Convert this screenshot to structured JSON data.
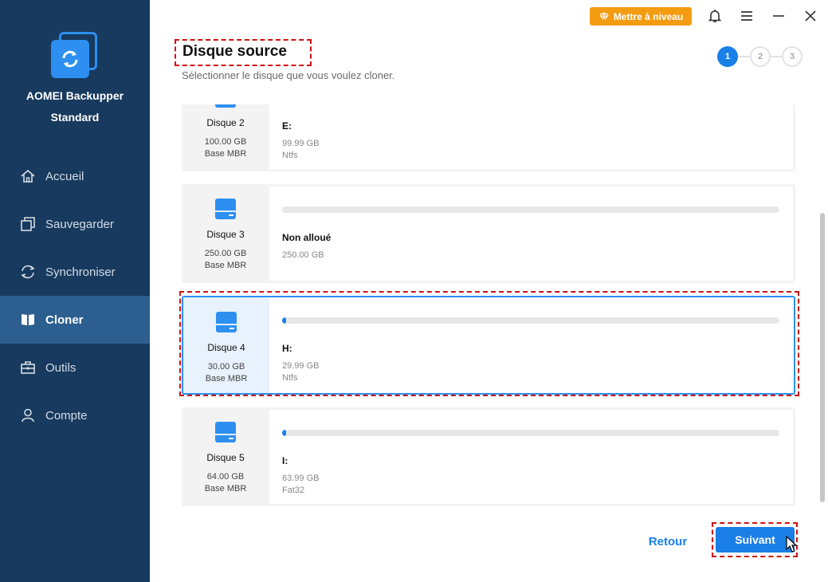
{
  "app": {
    "name": "AOMEI Backupper",
    "edition": "Standard"
  },
  "sidebar": {
    "items": [
      {
        "label": "Accueil",
        "icon": "home-icon",
        "active": false
      },
      {
        "label": "Sauvegarder",
        "icon": "copy-icon",
        "active": false
      },
      {
        "label": "Synchroniser",
        "icon": "sync-icon",
        "active": false
      },
      {
        "label": "Cloner",
        "icon": "clone-icon",
        "active": true
      },
      {
        "label": "Outils",
        "icon": "toolbox-icon",
        "active": false
      },
      {
        "label": "Compte",
        "icon": "user-icon",
        "active": false
      }
    ]
  },
  "topbar": {
    "upgrade_label": "Mettre à niveau"
  },
  "header": {
    "title": "Disque source",
    "subtitle": "Sélectionner le disque que vous voulez cloner."
  },
  "steps": [
    "1",
    "2",
    "3"
  ],
  "disks": [
    {
      "name": "Disque 2",
      "size": "100.00 GB",
      "type": "Base MBR",
      "partition": "E:",
      "part_size": "99.99 GB",
      "fs": "Ntfs",
      "usage": 0.0
    },
    {
      "name": "Disque 3",
      "size": "250.00 GB",
      "type": "Base MBR",
      "partition": "Non alloué",
      "part_size": "250.00 GB",
      "fs": "",
      "usage": 0.0
    },
    {
      "name": "Disque 4",
      "size": "30.00 GB",
      "type": "Base MBR",
      "partition": "H:",
      "part_size": "29.99 GB",
      "fs": "Ntfs",
      "usage": 0.006,
      "selected": true
    },
    {
      "name": "Disque 5",
      "size": "64.00 GB",
      "type": "Base MBR",
      "partition": "I:",
      "part_size": "63.99 GB",
      "fs": "Fat32",
      "usage": 0.006
    }
  ],
  "buttons": {
    "back": "Retour",
    "next": "Suivant"
  },
  "colors": {
    "sidebar": "#173a5e",
    "accent": "#1a7fe6",
    "upgrade": "#f39c12",
    "highlight": "#d01010"
  }
}
